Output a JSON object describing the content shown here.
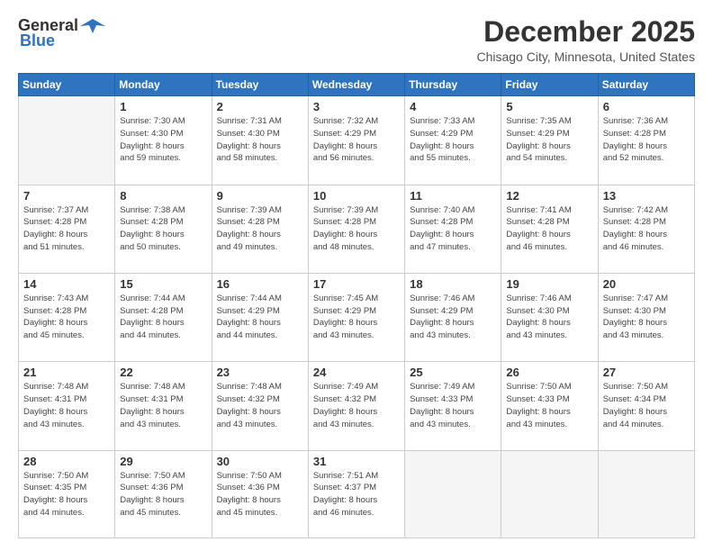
{
  "logo": {
    "general": "General",
    "blue": "Blue"
  },
  "header": {
    "month": "December 2025",
    "location": "Chisago City, Minnesota, United States"
  },
  "weekdays": [
    "Sunday",
    "Monday",
    "Tuesday",
    "Wednesday",
    "Thursday",
    "Friday",
    "Saturday"
  ],
  "weeks": [
    [
      {
        "day": "",
        "info": ""
      },
      {
        "day": "1",
        "info": "Sunrise: 7:30 AM\nSunset: 4:30 PM\nDaylight: 8 hours\nand 59 minutes."
      },
      {
        "day": "2",
        "info": "Sunrise: 7:31 AM\nSunset: 4:30 PM\nDaylight: 8 hours\nand 58 minutes."
      },
      {
        "day": "3",
        "info": "Sunrise: 7:32 AM\nSunset: 4:29 PM\nDaylight: 8 hours\nand 56 minutes."
      },
      {
        "day": "4",
        "info": "Sunrise: 7:33 AM\nSunset: 4:29 PM\nDaylight: 8 hours\nand 55 minutes."
      },
      {
        "day": "5",
        "info": "Sunrise: 7:35 AM\nSunset: 4:29 PM\nDaylight: 8 hours\nand 54 minutes."
      },
      {
        "day": "6",
        "info": "Sunrise: 7:36 AM\nSunset: 4:28 PM\nDaylight: 8 hours\nand 52 minutes."
      }
    ],
    [
      {
        "day": "7",
        "info": "Sunrise: 7:37 AM\nSunset: 4:28 PM\nDaylight: 8 hours\nand 51 minutes."
      },
      {
        "day": "8",
        "info": "Sunrise: 7:38 AM\nSunset: 4:28 PM\nDaylight: 8 hours\nand 50 minutes."
      },
      {
        "day": "9",
        "info": "Sunrise: 7:39 AM\nSunset: 4:28 PM\nDaylight: 8 hours\nand 49 minutes."
      },
      {
        "day": "10",
        "info": "Sunrise: 7:39 AM\nSunset: 4:28 PM\nDaylight: 8 hours\nand 48 minutes."
      },
      {
        "day": "11",
        "info": "Sunrise: 7:40 AM\nSunset: 4:28 PM\nDaylight: 8 hours\nand 47 minutes."
      },
      {
        "day": "12",
        "info": "Sunrise: 7:41 AM\nSunset: 4:28 PM\nDaylight: 8 hours\nand 46 minutes."
      },
      {
        "day": "13",
        "info": "Sunrise: 7:42 AM\nSunset: 4:28 PM\nDaylight: 8 hours\nand 46 minutes."
      }
    ],
    [
      {
        "day": "14",
        "info": "Sunrise: 7:43 AM\nSunset: 4:28 PM\nDaylight: 8 hours\nand 45 minutes."
      },
      {
        "day": "15",
        "info": "Sunrise: 7:44 AM\nSunset: 4:28 PM\nDaylight: 8 hours\nand 44 minutes."
      },
      {
        "day": "16",
        "info": "Sunrise: 7:44 AM\nSunset: 4:29 PM\nDaylight: 8 hours\nand 44 minutes."
      },
      {
        "day": "17",
        "info": "Sunrise: 7:45 AM\nSunset: 4:29 PM\nDaylight: 8 hours\nand 43 minutes."
      },
      {
        "day": "18",
        "info": "Sunrise: 7:46 AM\nSunset: 4:29 PM\nDaylight: 8 hours\nand 43 minutes."
      },
      {
        "day": "19",
        "info": "Sunrise: 7:46 AM\nSunset: 4:30 PM\nDaylight: 8 hours\nand 43 minutes."
      },
      {
        "day": "20",
        "info": "Sunrise: 7:47 AM\nSunset: 4:30 PM\nDaylight: 8 hours\nand 43 minutes."
      }
    ],
    [
      {
        "day": "21",
        "info": "Sunrise: 7:48 AM\nSunset: 4:31 PM\nDaylight: 8 hours\nand 43 minutes."
      },
      {
        "day": "22",
        "info": "Sunrise: 7:48 AM\nSunset: 4:31 PM\nDaylight: 8 hours\nand 43 minutes."
      },
      {
        "day": "23",
        "info": "Sunrise: 7:48 AM\nSunset: 4:32 PM\nDaylight: 8 hours\nand 43 minutes."
      },
      {
        "day": "24",
        "info": "Sunrise: 7:49 AM\nSunset: 4:32 PM\nDaylight: 8 hours\nand 43 minutes."
      },
      {
        "day": "25",
        "info": "Sunrise: 7:49 AM\nSunset: 4:33 PM\nDaylight: 8 hours\nand 43 minutes."
      },
      {
        "day": "26",
        "info": "Sunrise: 7:50 AM\nSunset: 4:33 PM\nDaylight: 8 hours\nand 43 minutes."
      },
      {
        "day": "27",
        "info": "Sunrise: 7:50 AM\nSunset: 4:34 PM\nDaylight: 8 hours\nand 44 minutes."
      }
    ],
    [
      {
        "day": "28",
        "info": "Sunrise: 7:50 AM\nSunset: 4:35 PM\nDaylight: 8 hours\nand 44 minutes."
      },
      {
        "day": "29",
        "info": "Sunrise: 7:50 AM\nSunset: 4:36 PM\nDaylight: 8 hours\nand 45 minutes."
      },
      {
        "day": "30",
        "info": "Sunrise: 7:50 AM\nSunset: 4:36 PM\nDaylight: 8 hours\nand 45 minutes."
      },
      {
        "day": "31",
        "info": "Sunrise: 7:51 AM\nSunset: 4:37 PM\nDaylight: 8 hours\nand 46 minutes."
      },
      {
        "day": "",
        "info": ""
      },
      {
        "day": "",
        "info": ""
      },
      {
        "day": "",
        "info": ""
      }
    ]
  ]
}
